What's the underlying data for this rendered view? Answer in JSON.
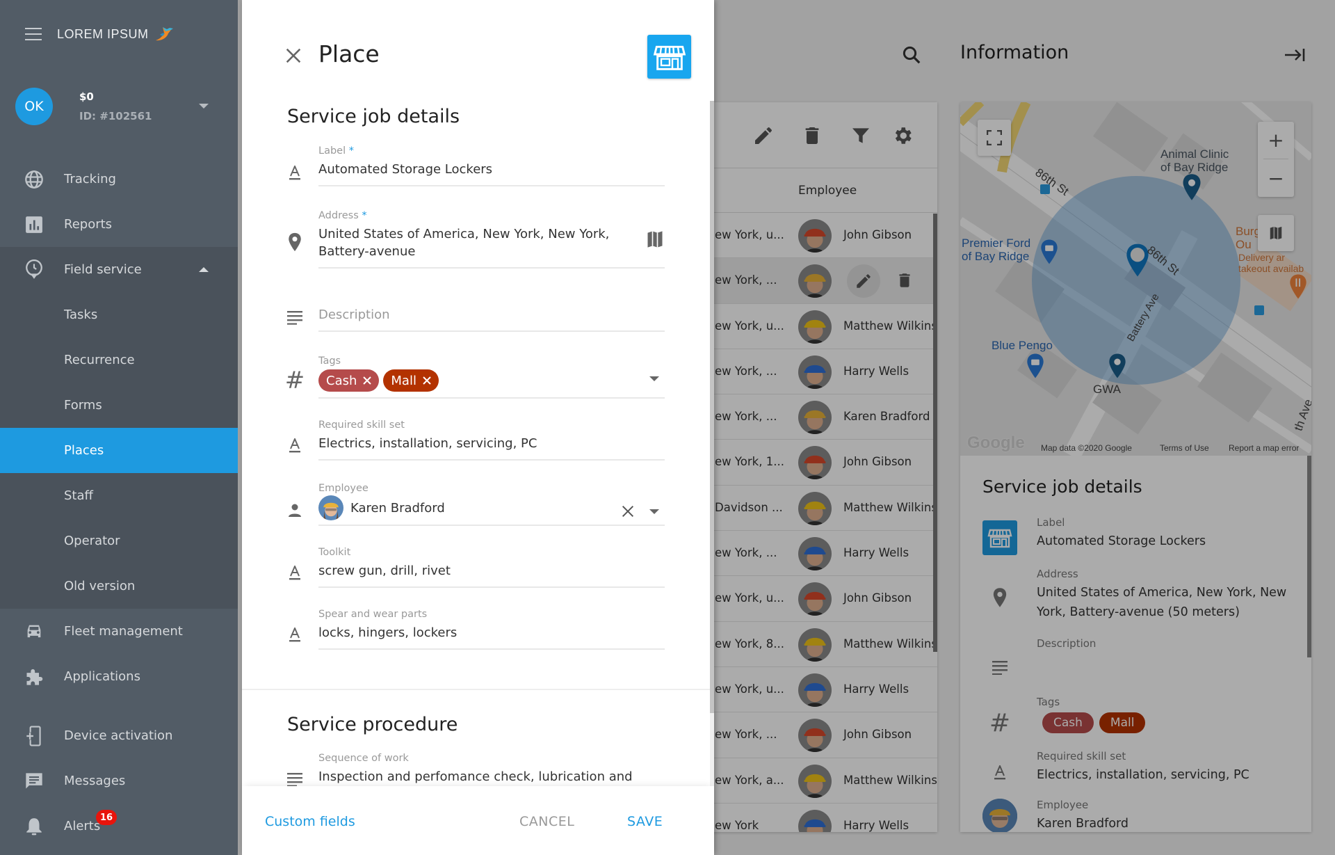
{
  "app": {
    "brand": "LOREM IPSUM",
    "account": {
      "initials": "OK",
      "balance": "$0",
      "id": "ID: #102561"
    }
  },
  "sidebar": {
    "items": [
      {
        "label": "Tracking",
        "icon": "globe-icon"
      },
      {
        "label": "Reports",
        "icon": "bar-chart-icon"
      },
      {
        "label": "Field service",
        "icon": "clock-pin-icon",
        "expanded": true,
        "children": [
          {
            "label": "Tasks"
          },
          {
            "label": "Recurrence"
          },
          {
            "label": "Forms"
          },
          {
            "label": "Places",
            "active": true
          },
          {
            "label": "Staff"
          },
          {
            "label": "Operator"
          },
          {
            "label": "Old version"
          }
        ]
      },
      {
        "label": "Fleet management",
        "icon": "car-icon"
      },
      {
        "label": "Applications",
        "icon": "puzzle-icon"
      },
      {
        "label": "Device activation",
        "icon": "device-add-icon"
      },
      {
        "label": "Messages",
        "icon": "message-icon"
      },
      {
        "label": "Alerts",
        "icon": "bell-icon",
        "badge": "16"
      }
    ]
  },
  "modal": {
    "title": "Place",
    "section1_title": "Service job details",
    "fields": {
      "label": {
        "label": "Label",
        "required": "*",
        "value": "Automated Storage Lockers"
      },
      "address": {
        "label": "Address",
        "required": "*",
        "value": "United States of America, New York, New York, Battery-avenue"
      },
      "description": {
        "placeholder": "Description",
        "value": ""
      },
      "tags": {
        "label": "Tags",
        "chips": [
          {
            "text": "Cash",
            "color": "#b54b4b"
          },
          {
            "text": "Mall",
            "color": "#b33200"
          }
        ]
      },
      "skills": {
        "label": "Required skill set",
        "value": "Electrics, installation, servicing, PC"
      },
      "employee": {
        "label": "Employee",
        "value": "Karen Bradford"
      },
      "toolkit": {
        "label": "Toolkit",
        "value": "screw gun, drill, rivet"
      },
      "parts": {
        "label": "Spear and wear parts",
        "value": "locks, hingers, lockers"
      }
    },
    "section2_title": "Service procedure",
    "sequence": {
      "label": "Sequence of work",
      "value": "Inspection and perfomance check, lubrication and"
    },
    "footer": {
      "custom_fields": "Custom fields",
      "cancel": "CANCEL",
      "save": "SAVE"
    }
  },
  "table": {
    "column_header": "Employee",
    "rows": [
      {
        "address": "ew York, u...",
        "employee": "John Gibson",
        "helmet": "#d9482b"
      },
      {
        "address": "ew York, ...",
        "employee": "Karen Bradford",
        "helmet": "#e8b23a",
        "hovered": true
      },
      {
        "address": "ew York, u...",
        "employee": "Matthew Wilkins",
        "helmet": "#f0c419"
      },
      {
        "address": "ew York, ...",
        "employee": "Harry Wells",
        "helmet": "#2f6fd6"
      },
      {
        "address": "ew York, ...",
        "employee": "Karen Bradford",
        "helmet": "#e8b23a"
      },
      {
        "address": "ew York, 1...",
        "employee": "John Gibson",
        "helmet": "#d9482b"
      },
      {
        "address": "Davidson ...",
        "employee": "Matthew Wilkins",
        "helmet": "#f0c419"
      },
      {
        "address": "ew York, ...",
        "employee": "Harry Wells",
        "helmet": "#2f6fd6"
      },
      {
        "address": "ew York, u...",
        "employee": "John Gibson",
        "helmet": "#d9482b"
      },
      {
        "address": "ew York, 8...",
        "employee": "Matthew Wilkins",
        "helmet": "#f0c419"
      },
      {
        "address": "ew York, u...",
        "employee": "Harry Wells",
        "helmet": "#2f6fd6"
      },
      {
        "address": "ew York, ...",
        "employee": "John Gibson",
        "helmet": "#d9482b"
      },
      {
        "address": "ew York, a...",
        "employee": "Matthew Wilkins",
        "helmet": "#f0c419"
      },
      {
        "address": "ew York",
        "employee": "Harry Wells",
        "helmet": "#2f6fd6"
      }
    ]
  },
  "info": {
    "title": "Information",
    "map": {
      "labels": {
        "street1": "86th St",
        "street2": "86th St",
        "avenue": "Battery Ave",
        "animal_clinic": "Animal Clinic\nof Bay Ridge",
        "premier_ford": "Premier Ford\nof Bay Ridge",
        "blue_pengo": "Blue Pengo",
        "gwa": "GWA",
        "burger": "Burg   Tak\nOu    abl",
        "delivery": "Delivery ar\ntakeout availab",
        "seventh_ave": "th Ave"
      },
      "zoom_in": "+",
      "zoom_out": "−",
      "google": "Google",
      "map_data": "Map data ©2020 Google",
      "terms": "Terms of Use",
      "report": "Report a map error"
    },
    "section_title": "Service job details",
    "rows": {
      "label": {
        "label": "Label",
        "value": "Automated Storage Lockers"
      },
      "address": {
        "label": "Address",
        "value": "United States of America, New York, New York, Battery-avenue (50 meters)"
      },
      "description": {
        "label": "Description",
        "value": ""
      },
      "tags": {
        "label": "Tags",
        "chips": [
          {
            "text": "Cash",
            "color": "#b54b4b"
          },
          {
            "text": "Mall",
            "color": "#b33200"
          }
        ]
      },
      "skills": {
        "label": "Required skill set",
        "value": "Electrics, installation, servicing, PC"
      },
      "employee": {
        "label": "Employee",
        "value": "Karen Bradford"
      }
    }
  }
}
